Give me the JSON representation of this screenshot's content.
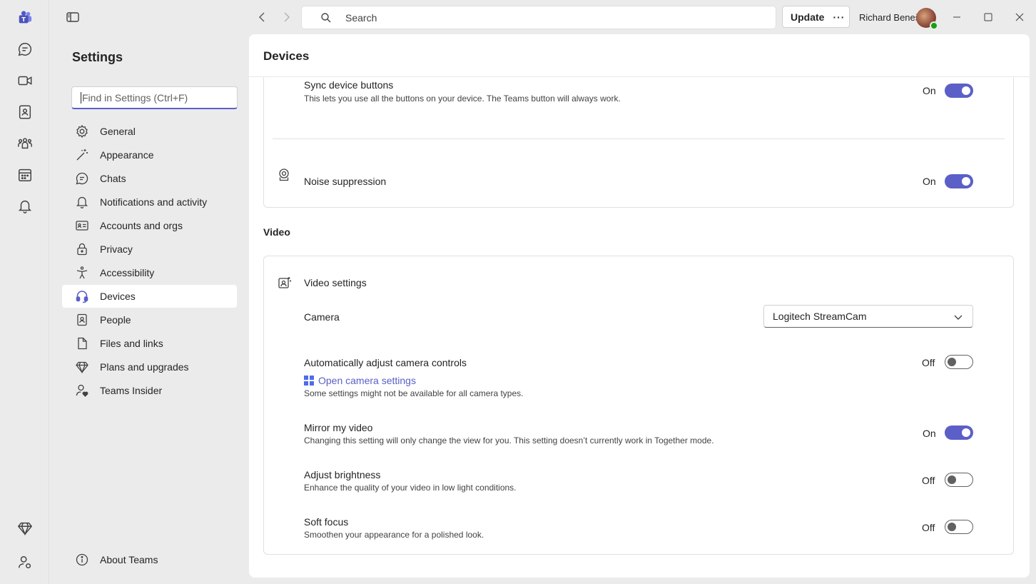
{
  "titlebar": {
    "search_placeholder": "Search",
    "update_label": "Update",
    "more_label": "···",
    "user_name": "Richard Beneš"
  },
  "sidebar": {
    "title": "Settings",
    "search_placeholder": "Find in Settings (Ctrl+F)",
    "items": [
      {
        "label": "General",
        "icon": "gear-icon"
      },
      {
        "label": "Appearance",
        "icon": "magic-wand-icon"
      },
      {
        "label": "Chats",
        "icon": "chat-icon"
      },
      {
        "label": "Notifications and activity",
        "icon": "bell-icon"
      },
      {
        "label": "Accounts and orgs",
        "icon": "id-card-icon"
      },
      {
        "label": "Privacy",
        "icon": "lock-icon"
      },
      {
        "label": "Accessibility",
        "icon": "accessibility-icon"
      },
      {
        "label": "Devices",
        "icon": "headset-icon"
      },
      {
        "label": "People",
        "icon": "contact-icon"
      },
      {
        "label": "Files and links",
        "icon": "document-icon"
      },
      {
        "label": "Plans and upgrades",
        "icon": "diamond-icon"
      },
      {
        "label": "Teams Insider",
        "icon": "person-heart-icon"
      }
    ],
    "active_index": 7,
    "about_label": "About Teams"
  },
  "main": {
    "title": "Devices",
    "audio_card": {
      "sync": {
        "title": "Sync device buttons",
        "desc": "This lets you use all the buttons on your device. The Teams button will always work.",
        "state": "On"
      },
      "noise": {
        "title": "Noise suppression",
        "state": "On"
      }
    },
    "video_section": {
      "heading": "Video",
      "card_title": "Video settings",
      "camera_label": "Camera",
      "camera_value": "Logitech StreamCam",
      "auto_adjust": {
        "title": "Automatically adjust camera controls",
        "state": "Off",
        "link": "Open camera settings",
        "desc": "Some settings might not be available for all camera types."
      },
      "mirror": {
        "title": "Mirror my video",
        "desc": "Changing this setting will only change the view for you. This setting doesn’t currently work in Together mode.",
        "state": "On"
      },
      "brightness": {
        "title": "Adjust brightness",
        "desc": "Enhance the quality of your video in low light conditions.",
        "state": "Off"
      },
      "soft_focus": {
        "title": "Soft focus",
        "desc": "Smoothen your appearance for a polished look.",
        "state": "Off"
      }
    }
  },
  "colors": {
    "accent": "#5b5fc7",
    "background": "#ebebeb",
    "panel": "#ffffff"
  }
}
